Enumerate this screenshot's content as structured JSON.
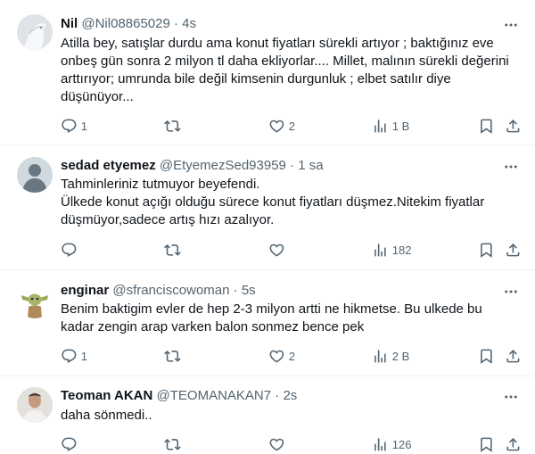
{
  "tweets": [
    {
      "name": "Nil",
      "handle": "@Nil08865029",
      "dot": "·",
      "time": "4s",
      "lines": [
        "Atilla bey, satışlar durdu ama konut fiyatları sürekli artıyor ; baktığınız eve",
        "onbeş gün sonra 2 milyon tl daha ekliyorlar.... Millet, malının sürekli değerini",
        "arttırıyor; umrunda bile değil kimsenin durgunluk ; elbet satılır diye",
        "düşünüyor..."
      ],
      "replies": "1",
      "retweets": "",
      "likes": "2",
      "views": "1 B"
    },
    {
      "name": "sedad etyemez",
      "handle": "@EtyemezSed93959",
      "dot": "·",
      "time": "1 sa",
      "lines": [
        "Tahminleriniz tutmuyor beyefendi.",
        "Ülkede konut açığı olduğu sürece konut fiyatları düşmez.Nitekim fiyatlar",
        "düşmüyor,sadece artış hızı azalıyor."
      ],
      "replies": "",
      "retweets": "",
      "likes": "",
      "views": "182"
    },
    {
      "name": "enginar",
      "handle": "@sfranciscowoman",
      "dot": "·",
      "time": "5s",
      "lines": [
        "Benim baktigim evler de hep 2-3 milyon artti ne hikmetse. Bu ulkede bu",
        "kadar zengin arap varken balon sonmez bence pek"
      ],
      "replies": "1",
      "retweets": "",
      "likes": "2",
      "views": "2 B"
    },
    {
      "name": "Teoman AKAN",
      "handle": "@TEOMANAKAN7",
      "dot": "·",
      "time": "2s",
      "lines": [
        "daha sönmedi.."
      ],
      "replies": "",
      "retweets": "",
      "likes": "",
      "views": "126"
    }
  ],
  "icons": {
    "reply": "reply-icon",
    "retweet": "retweet-icon",
    "like": "heart-icon",
    "views": "views-chart-icon",
    "bookmark": "bookmark-icon",
    "share": "share-icon",
    "more": "more-dots-icon"
  },
  "colors": {
    "text": "#0f1419",
    "muted": "#536471",
    "divider": "#eff3f4"
  }
}
